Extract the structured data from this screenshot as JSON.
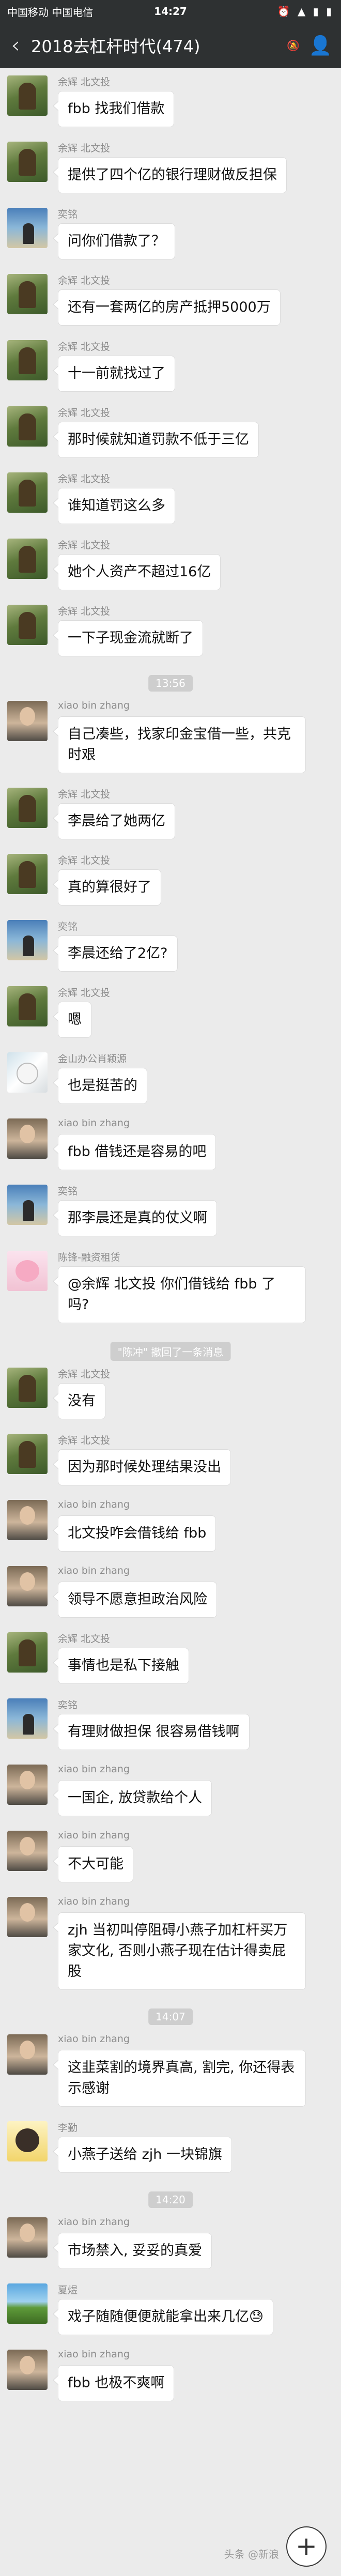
{
  "status_bar": {
    "carrier": "中国移动 中国电信",
    "time": "14:27",
    "right": "⏰ ▲ ▮ ▮"
  },
  "header": {
    "back_icon": "‹",
    "title": "2018去杠杆时代(474)",
    "mute_icon": "🔕",
    "group_icon": "👤"
  },
  "messages": [
    {
      "type": "msg",
      "sender": "余辉 北文投",
      "avatar": "forest",
      "text": "fbb 找我们借款"
    },
    {
      "type": "msg",
      "sender": "余辉 北文投",
      "avatar": "forest",
      "text": "提供了四个亿的银行理财做反担保"
    },
    {
      "type": "msg",
      "sender": "奕铭",
      "avatar": "sky",
      "text": "问你们借款了？"
    },
    {
      "type": "msg",
      "sender": "余辉 北文投",
      "avatar": "forest",
      "text": "还有一套两亿的房产抵押5000万"
    },
    {
      "type": "msg",
      "sender": "余辉 北文投",
      "avatar": "forest",
      "text": "十一前就找过了"
    },
    {
      "type": "msg",
      "sender": "余辉 北文投",
      "avatar": "forest",
      "text": "那时候就知道罚款不低于三亿"
    },
    {
      "type": "msg",
      "sender": "余辉 北文投",
      "avatar": "forest",
      "text": "谁知道罚这么多"
    },
    {
      "type": "msg",
      "sender": "余辉 北文投",
      "avatar": "forest",
      "text": "她个人资产不超过16亿"
    },
    {
      "type": "msg",
      "sender": "余辉 北文投",
      "avatar": "forest",
      "text": "一下子现金流就断了"
    },
    {
      "type": "time",
      "text": "13:56"
    },
    {
      "type": "msg",
      "sender": "xiao bin zhang",
      "avatar": "man",
      "text": "自己凑些，找家印金宝借一些，共克时艰"
    },
    {
      "type": "msg",
      "sender": "余辉 北文投",
      "avatar": "forest",
      "text": "李晨给了她两亿"
    },
    {
      "type": "msg",
      "sender": "余辉 北文投",
      "avatar": "forest",
      "text": "真的算很好了"
    },
    {
      "type": "msg",
      "sender": "奕铭",
      "avatar": "sky",
      "text": "李晨还给了2亿?"
    },
    {
      "type": "msg",
      "sender": "余辉 北文投",
      "avatar": "forest",
      "text": "嗯"
    },
    {
      "type": "msg",
      "sender": "金山办公肖颖源",
      "avatar": "snow",
      "text": "也是挺苦的"
    },
    {
      "type": "msg",
      "sender": "xiao bin zhang",
      "avatar": "man",
      "text": "fbb 借钱还是容易的吧"
    },
    {
      "type": "msg",
      "sender": "奕铭",
      "avatar": "sky",
      "text": "那李晨还是真的仗义啊"
    },
    {
      "type": "msg",
      "sender": "陈锋-融资租赁",
      "avatar": "pig",
      "text": "@余辉 北文投  你们借钱给 fbb 了吗?"
    },
    {
      "type": "note",
      "text": "\"陈冲\" 撤回了一条消息"
    },
    {
      "type": "msg",
      "sender": "余辉 北文投",
      "avatar": "forest",
      "text": "没有"
    },
    {
      "type": "msg",
      "sender": "余辉 北文投",
      "avatar": "forest",
      "text": "因为那时候处理结果没出"
    },
    {
      "type": "msg",
      "sender": "xiao bin zhang",
      "avatar": "man",
      "text": "北文投咋会借钱给 fbb"
    },
    {
      "type": "msg",
      "sender": "xiao bin zhang",
      "avatar": "man",
      "text": "领导不愿意担政治风险"
    },
    {
      "type": "msg",
      "sender": "余辉 北文投",
      "avatar": "forest",
      "text": "事情也是私下接触"
    },
    {
      "type": "msg",
      "sender": "奕铭",
      "avatar": "sky",
      "text": "有理财做担保 很容易借钱啊"
    },
    {
      "type": "msg",
      "sender": "xiao bin zhang",
      "avatar": "man",
      "text": "一国企, 放贷款给个人"
    },
    {
      "type": "msg",
      "sender": "xiao bin zhang",
      "avatar": "man",
      "text": "不大可能"
    },
    {
      "type": "msg",
      "sender": "xiao bin zhang",
      "avatar": "man",
      "text": "zjh 当初叫停阻碍小燕子加杠杆买万家文化, 否则小燕子现在估计得卖屁股"
    },
    {
      "type": "time",
      "text": "14:07"
    },
    {
      "type": "msg",
      "sender": "xiao bin zhang",
      "avatar": "man",
      "text": "这韭菜割的境界真高, 割完, 你还得表示感谢"
    },
    {
      "type": "msg",
      "sender": "李勤",
      "avatar": "cartoon",
      "text": "小燕子送给 zjh 一块锦旗"
    },
    {
      "type": "time",
      "text": "14:20"
    },
    {
      "type": "msg",
      "sender": "xiao bin zhang",
      "avatar": "man",
      "text": "市场禁入, 妥妥的真爱"
    },
    {
      "type": "msg",
      "sender": "夏煜",
      "avatar": "land",
      "text": "戏子随随便便就能拿出来几亿😓"
    },
    {
      "type": "msg",
      "sender": "xiao bin zhang",
      "avatar": "man",
      "text": "fbb 也极不爽啊"
    }
  ],
  "fab_icon": "+",
  "watermark": "头条 @新浪"
}
